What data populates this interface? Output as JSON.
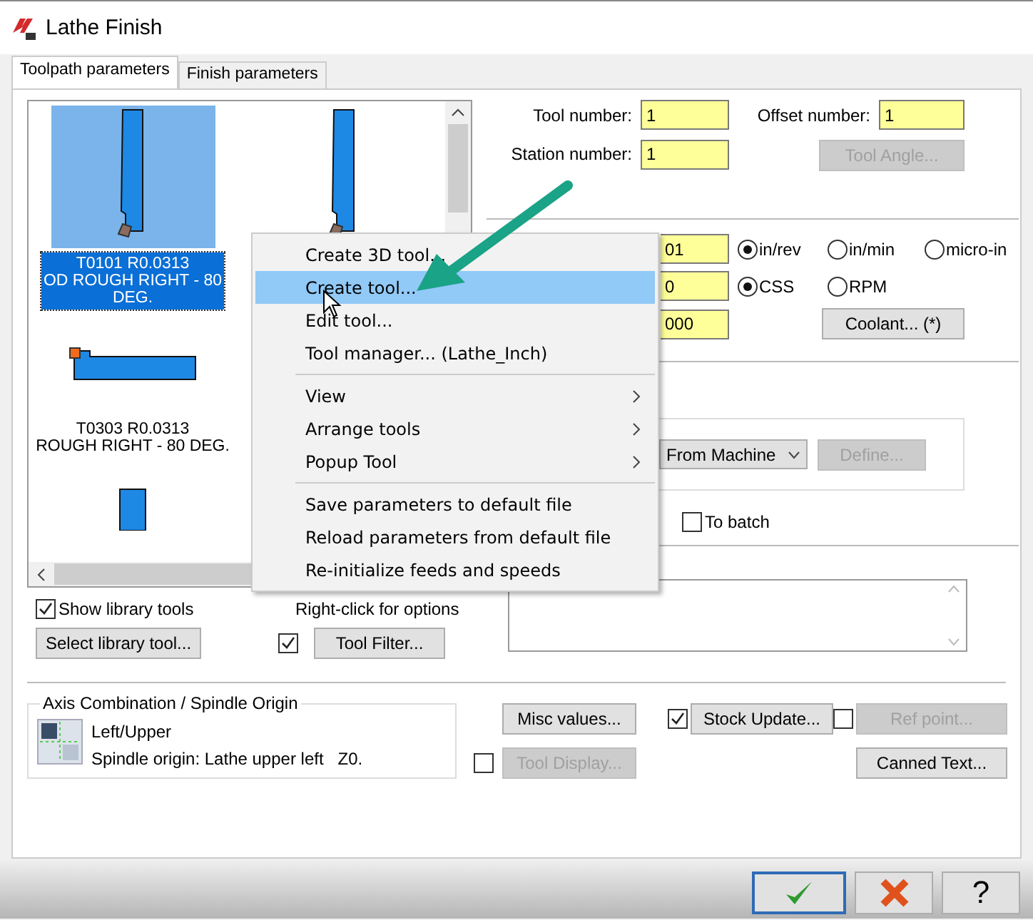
{
  "window": {
    "title": "Lathe Finish"
  },
  "tabs": [
    {
      "label": "Toolpath parameters",
      "selected": true
    },
    {
      "label": "Finish parameters",
      "selected": false
    }
  ],
  "tool_list": {
    "columns": [
      [
        {
          "kind": "vertical",
          "selected": true,
          "lines": [
            "T0101 R0.0313",
            "OD ROUGH RIGHT - 80",
            "DEG."
          ]
        },
        {
          "kind": "horizontal",
          "selected": false,
          "lines": [
            "T0303 R0.0313",
            "ROUGH RIGHT - 80 DEG."
          ]
        },
        {
          "kind": "stub",
          "selected": false
        }
      ],
      [
        {
          "kind": "vertical",
          "selected": false
        }
      ]
    ]
  },
  "show_library_tools": {
    "label": "Show library tools",
    "checked": true
  },
  "hint": "Right-click for options",
  "select_library_tool": {
    "label": "Select library tool...",
    "disabled": false
  },
  "tool_filter": {
    "label": "Tool Filter...",
    "checked": true,
    "disabled": false
  },
  "tool_fields": [
    {
      "label": "Tool number:",
      "value": "1"
    },
    {
      "label": "Offset number:",
      "value": "1"
    },
    {
      "label": "Station number:",
      "value": "1"
    }
  ],
  "tool_angle": {
    "label": "Tool Angle...",
    "disabled": true
  },
  "feed_fields": [
    {
      "value": "01"
    },
    {
      "value": "0"
    },
    {
      "value": "000"
    }
  ],
  "feed_units": [
    {
      "label": "in/rev",
      "selected": true
    },
    {
      "label": "in/min",
      "selected": false
    },
    {
      "label": "micro-in",
      "selected": false
    }
  ],
  "speed_modes": [
    {
      "label": "CSS",
      "selected": true
    },
    {
      "label": "RPM",
      "selected": false
    }
  ],
  "coolant": {
    "label": "Coolant... (*)",
    "disabled": false
  },
  "machine_dropdown": {
    "value": "From Machine"
  },
  "define": {
    "label": "Define...",
    "disabled": true
  },
  "to_batch": {
    "label": "To batch",
    "checked": false
  },
  "axis_group": {
    "title": "Axis Combination / Spindle Origin",
    "name": "Left/Upper",
    "origin": "Spindle origin: Lathe upper left   Z0."
  },
  "misc_values": {
    "label": "Misc values...",
    "disabled": false
  },
  "tool_display": {
    "label": "Tool Display...",
    "checked": false,
    "disabled": true
  },
  "stock_update": {
    "label": "Stock Update...",
    "checked": true,
    "disabled": false
  },
  "ref_point": {
    "label": "Ref point...",
    "checked": false,
    "disabled": true
  },
  "canned_text": {
    "label": "Canned Text...",
    "disabled": false
  },
  "footer_buttons": [
    {
      "kind": "ok"
    },
    {
      "kind": "cancel"
    },
    {
      "kind": "help",
      "label": "?"
    }
  ],
  "context_menu": [
    {
      "kind": "item",
      "label": "Create 3D tool...",
      "selected": false
    },
    {
      "kind": "item",
      "label": "Create tool...",
      "selected": true
    },
    {
      "kind": "item",
      "label": "Edit tool...",
      "selected": false
    },
    {
      "kind": "item",
      "label": "Tool manager... (Lathe_Inch)",
      "selected": false
    },
    {
      "kind": "separator"
    },
    {
      "kind": "submenu",
      "label": "View",
      "selected": false
    },
    {
      "kind": "submenu",
      "label": "Arrange tools",
      "selected": false
    },
    {
      "kind": "submenu",
      "label": "Popup Tool",
      "selected": false
    },
    {
      "kind": "separator"
    },
    {
      "kind": "item",
      "label": "Save parameters to default file",
      "selected": false
    },
    {
      "kind": "item",
      "label": "Reload parameters from default file",
      "selected": false
    },
    {
      "kind": "item",
      "label": "Re-initialize feeds and speeds",
      "selected": false
    }
  ]
}
